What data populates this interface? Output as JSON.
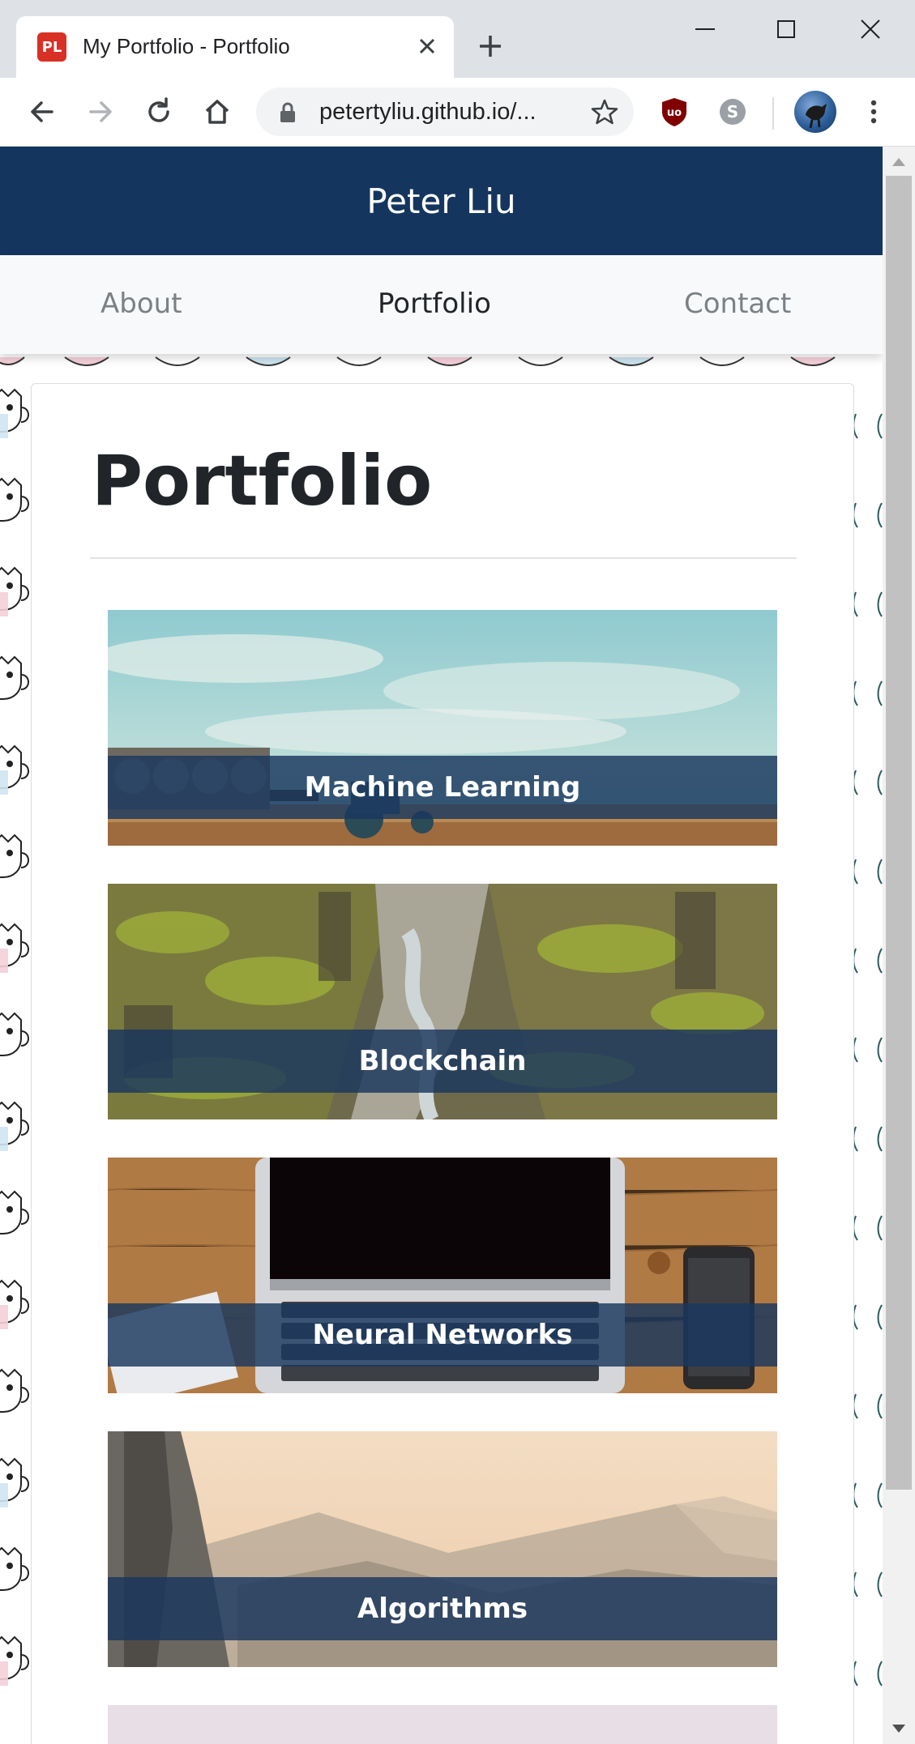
{
  "browser": {
    "tab_title": "My Portfolio - Portfolio",
    "favicon_text": "PL",
    "url": "petertyliu.github.io/...",
    "accent_color": "#d93025"
  },
  "site": {
    "title": "Peter Liu",
    "header_color": "#14365e"
  },
  "nav": {
    "items": [
      {
        "label": "About",
        "active": false
      },
      {
        "label": "Portfolio",
        "active": true
      },
      {
        "label": "Contact",
        "active": false
      }
    ]
  },
  "main": {
    "heading": "Portfolio",
    "tiles": [
      {
        "label": "Machine Learning",
        "image": "sky-and-field-with-tractor"
      },
      {
        "label": "Blockchain",
        "image": "mossy-canyon"
      },
      {
        "label": "Neural Networks",
        "image": "laptop-on-wooden-desk"
      },
      {
        "label": "Algorithms",
        "image": "misty-mountain-valley"
      }
    ]
  }
}
